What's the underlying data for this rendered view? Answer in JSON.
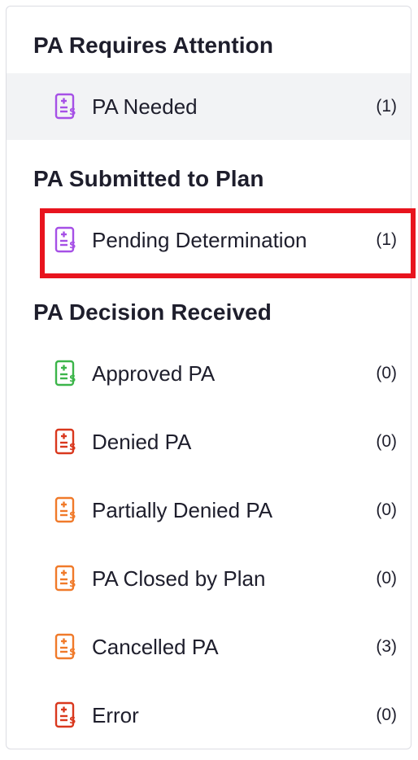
{
  "sections": [
    {
      "title": "PA Requires Attention",
      "items": [
        {
          "label": "PA Needed",
          "count": "(1)",
          "icon": "document-dollar-icon",
          "color": "#a650e6"
        }
      ]
    },
    {
      "title": "PA Submitted to Plan",
      "items": [
        {
          "label": "Pending Determination",
          "count": "(1)",
          "icon": "document-dollar-icon",
          "color": "#a650e6"
        }
      ]
    },
    {
      "title": "PA Decision Received",
      "items": [
        {
          "label": "Approved PA",
          "count": "(0)",
          "icon": "document-dollar-icon",
          "color": "#3cb54a"
        },
        {
          "label": "Denied PA",
          "count": "(0)",
          "icon": "document-dollar-icon",
          "color": "#d9381e"
        },
        {
          "label": "Partially Denied PA",
          "count": "(0)",
          "icon": "document-dollar-icon",
          "color": "#f07a2a"
        },
        {
          "label": "PA Closed by Plan",
          "count": "(0)",
          "icon": "document-dollar-icon",
          "color": "#f07a2a"
        },
        {
          "label": "Cancelled PA",
          "count": "(3)",
          "icon": "document-dollar-icon",
          "color": "#f07a2a"
        },
        {
          "label": "Error",
          "count": "(0)",
          "icon": "document-dollar-icon",
          "color": "#d9381e"
        }
      ]
    }
  ],
  "highlight_color": "#e8141e",
  "active_item": "PA Needed"
}
